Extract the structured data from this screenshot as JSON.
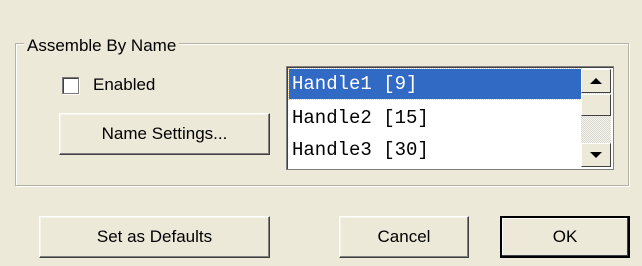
{
  "group": {
    "title": "Assemble By Name"
  },
  "enabled": {
    "label": "Enabled",
    "checked": false
  },
  "buttons": {
    "name_settings": "Name Settings...",
    "set_defaults": "Set as Defaults",
    "cancel": "Cancel",
    "ok": "OK"
  },
  "list": {
    "items": [
      "Handle1 [9]",
      "Handle2 [15]",
      "Handle3 [30]"
    ],
    "selected_index": 0
  },
  "icons": {
    "scroll_up": "scroll-up-arrow-icon",
    "scroll_down": "scroll-down-arrow-icon"
  },
  "colors": {
    "background": "#ece9d8",
    "selection": "#316ac5"
  }
}
